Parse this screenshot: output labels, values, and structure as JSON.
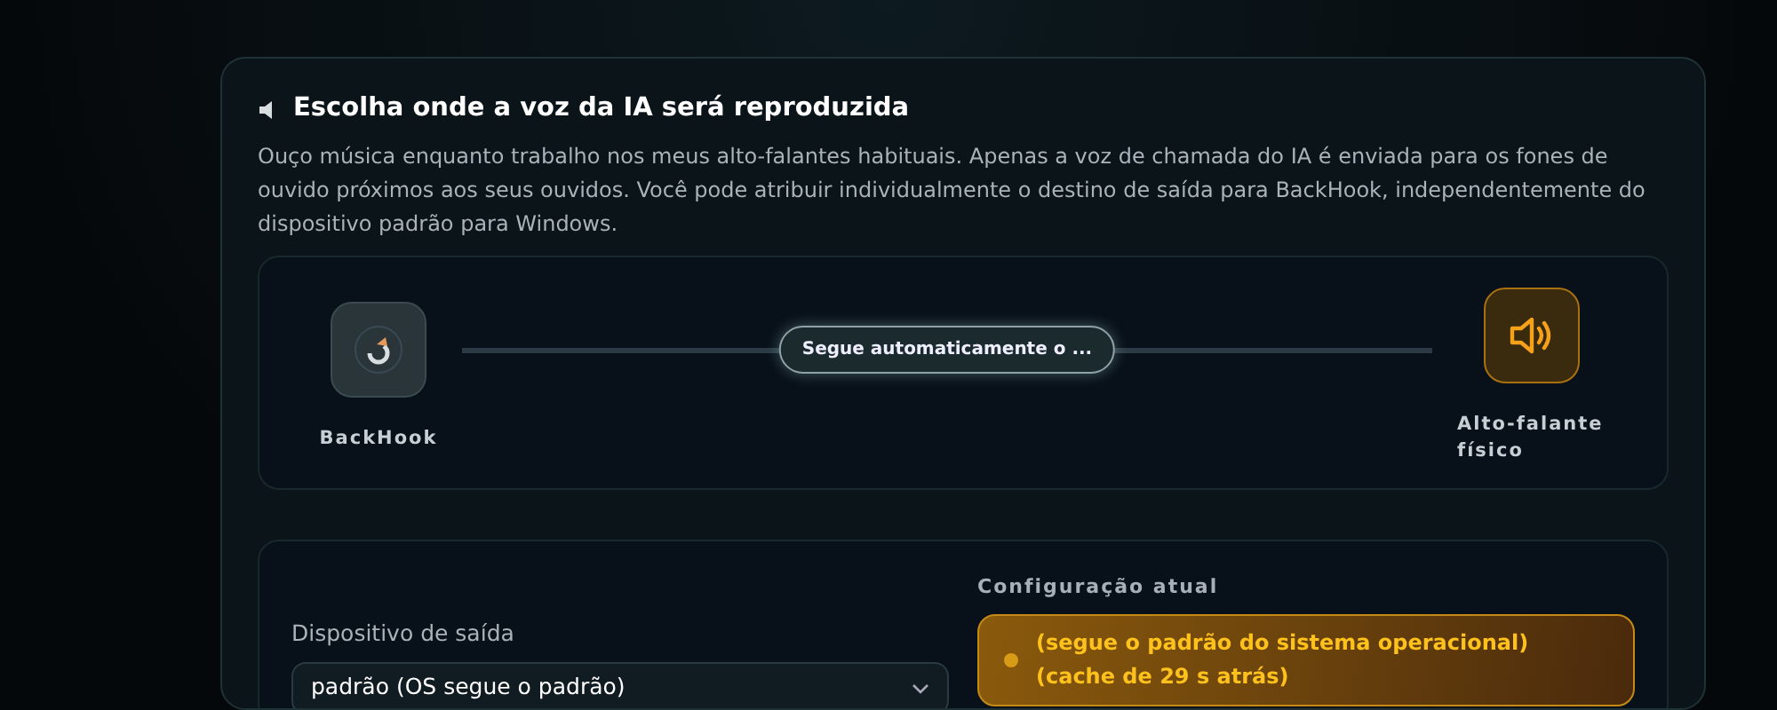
{
  "section": {
    "title": "Escolha onde a voz da IA será reproduzida",
    "description": "Ouço música enquanto trabalho nos meus alto-falantes habituais. Apenas a voz de chamada do IA é enviada para os fones de ouvido próximos aos seus ouvidos. Você pode atribuir individualmente o destino de saída para BackHook, independentemente do dispositivo padrão para Windows."
  },
  "route": {
    "source": "BackHook",
    "connection": "Segue automaticamente o ...",
    "target": "Alto-falante físico"
  },
  "output": {
    "label": "Dispositivo de saída",
    "value": "padrão (OS segue o padrão)"
  },
  "current": {
    "label": "Configuração atual",
    "status": "(segue o padrão do sistema operacional) (cache de 29 s atrás)"
  }
}
